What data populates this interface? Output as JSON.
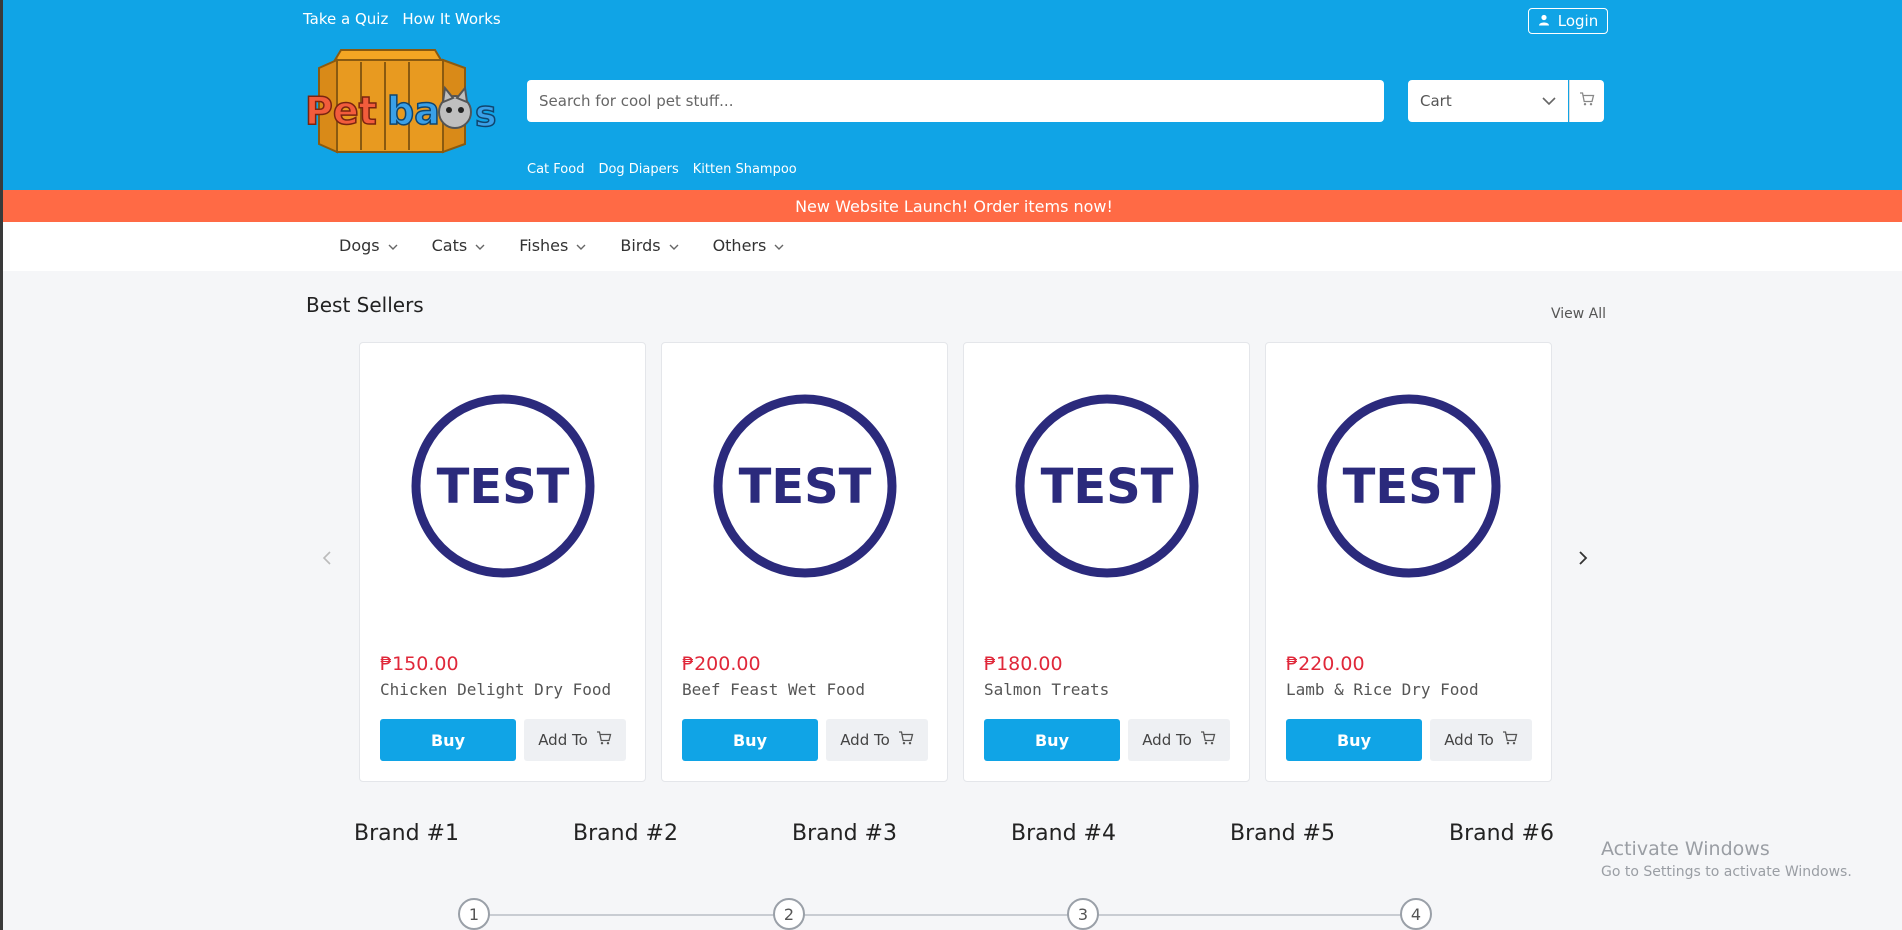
{
  "header": {
    "top_links": [
      "Take a Quiz",
      "How It Works"
    ],
    "login_label": "Login",
    "logo_text": "Petbaos",
    "search_placeholder": "Search for cool pet stuff...",
    "cart_label": "Cart",
    "quick_links": [
      "Cat Food",
      "Dog Diapers",
      "Kitten Shampoo"
    ]
  },
  "banner": {
    "text": "New Website Launch! Order items now!"
  },
  "category_nav": {
    "items": [
      {
        "label": "Dogs"
      },
      {
        "label": "Cats"
      },
      {
        "label": "Fishes"
      },
      {
        "label": "Birds"
      },
      {
        "label": "Others"
      }
    ]
  },
  "best_sellers": {
    "title": "Best Sellers",
    "view_all_label": "View All",
    "products": [
      {
        "price": "₱150.00",
        "name": "Chicken Delight Dry Food",
        "image_text": "TEST",
        "buy_label": "Buy",
        "add_label": "Add To"
      },
      {
        "price": "₱200.00",
        "name": "Beef Feast Wet Food",
        "image_text": "TEST",
        "buy_label": "Buy",
        "add_label": "Add To"
      },
      {
        "price": "₱180.00",
        "name": "Salmon Treats",
        "image_text": "TEST",
        "buy_label": "Buy",
        "add_label": "Add To"
      },
      {
        "price": "₱220.00",
        "name": "Lamb & Rice Dry Food",
        "image_text": "TEST",
        "buy_label": "Buy",
        "add_label": "Add To"
      }
    ]
  },
  "brands": [
    "Brand #1",
    "Brand #2",
    "Brand #3",
    "Brand #4",
    "Brand #5",
    "Brand #6"
  ],
  "steps": [
    "1",
    "2",
    "3",
    "4"
  ],
  "watermark": {
    "title": "Activate Windows",
    "subtitle": "Go to Settings to activate Windows."
  },
  "colors": {
    "header_bg": "#10a4e6",
    "banner_bg": "#ff6a45",
    "price": "#e0283a",
    "test_logo": "#2b2a7c"
  },
  "icons": [
    "user-icon",
    "chevron-down-icon",
    "cart-icon",
    "chevron-left-icon",
    "chevron-right-icon"
  ]
}
